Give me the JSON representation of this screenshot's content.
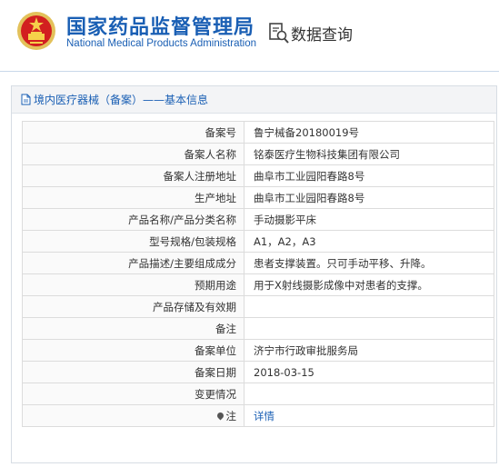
{
  "header": {
    "title_cn": "国家药品监督管理局",
    "title_en": "National Medical Products Administration",
    "query_label": "数据查询",
    "brand_color": "#1a5fb4"
  },
  "panel": {
    "title": "境内医疗器械（备案）——基本信息"
  },
  "rows": [
    {
      "label": "备案号",
      "value": "鲁宁械备20180019号"
    },
    {
      "label": "备案人名称",
      "value": "铭泰医疗生物科技集团有限公司"
    },
    {
      "label": "备案人注册地址",
      "value": "曲阜市工业园阳春路8号"
    },
    {
      "label": "生产地址",
      "value": "曲阜市工业园阳春路8号"
    },
    {
      "label": "产品名称/产品分类名称",
      "value": "手动摄影平床"
    },
    {
      "label": "型号规格/包装规格",
      "value": "A1，A2，A3"
    },
    {
      "label": "产品描述/主要组成成分",
      "value": "患者支撑装置。只可手动平移、升降。"
    },
    {
      "label": "预期用途",
      "value": "用于X射线摄影成像中对患者的支撑。"
    },
    {
      "label": "产品存储及有效期",
      "value": ""
    },
    {
      "label": "备注",
      "value": ""
    },
    {
      "label": "备案单位",
      "value": "济宁市行政审批服务局"
    },
    {
      "label": "备案日期",
      "value": "2018-03-15"
    },
    {
      "label": "变更情况",
      "value": ""
    },
    {
      "label": "注",
      "value": "详情"
    }
  ]
}
